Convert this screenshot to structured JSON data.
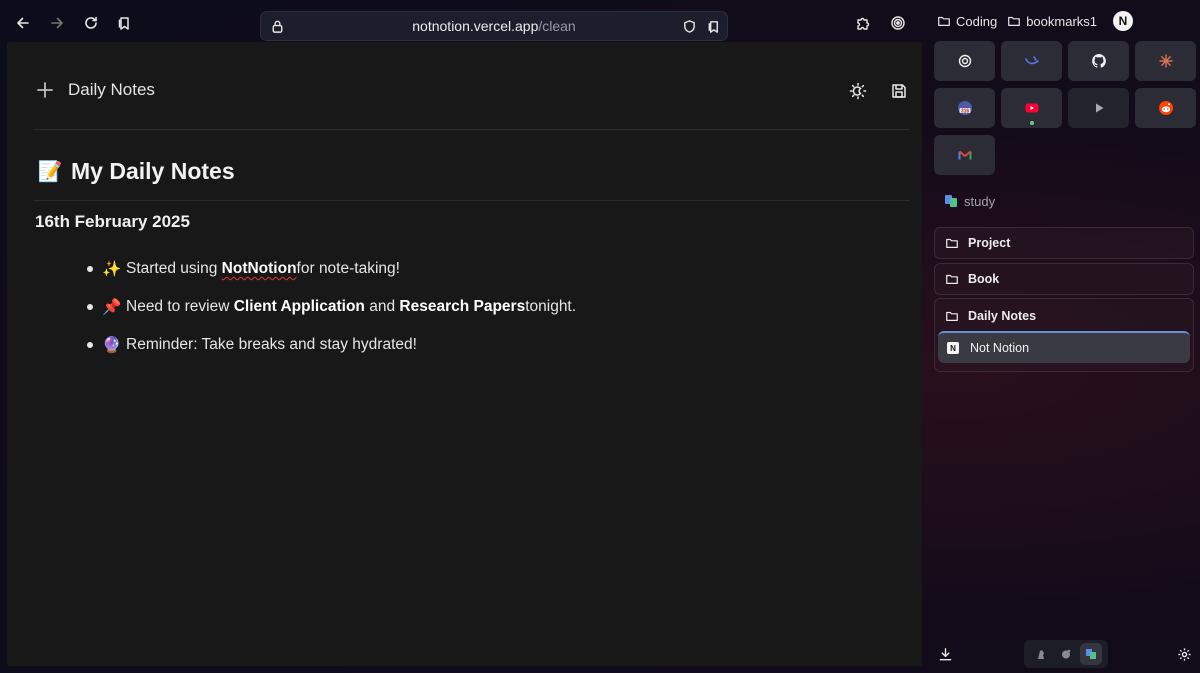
{
  "browser": {
    "url_host": "notnotion.vercel.app",
    "url_path": "/clean"
  },
  "document": {
    "title": "Daily Notes",
    "heading_emoji": "📝",
    "heading": "My Daily Notes",
    "date": "16th February 2025",
    "bullets": [
      {
        "emoji": "✨",
        "pre": "Started using ",
        "bold": "NotNotion",
        "post": " for note-taking!"
      },
      {
        "emoji": "📌",
        "pre": "Need to review ",
        "bold": "Client Application",
        "mid": " and ",
        "bold2": "Research Papers",
        "post": " tonight."
      },
      {
        "emoji": "🔮",
        "pre": "Reminder: Take breaks and stay hydrated!"
      }
    ]
  },
  "sidebar": {
    "bookmarks": [
      "Coding",
      "bookmarks1"
    ],
    "profile_initial": "N",
    "pinned": [
      {
        "icon": "openai-icon"
      },
      {
        "icon": "deepseek-icon"
      },
      {
        "icon": "github-icon"
      },
      {
        "icon": "claude-icon"
      },
      {
        "icon": "calendar-icon",
        "badge": "316"
      },
      {
        "icon": "youtube-icon"
      },
      {
        "icon": "play-icon"
      },
      {
        "icon": "reddit-icon"
      },
      {
        "icon": "gmail-icon"
      }
    ],
    "space_name": "study",
    "folders": [
      "Project",
      "Book",
      "Daily Notes"
    ],
    "open_tab": "Not Notion",
    "colors": {
      "accent_blue": "#6a8fd8",
      "youtube_red": "#ff0033",
      "reddit_orange": "#ff4500"
    }
  }
}
